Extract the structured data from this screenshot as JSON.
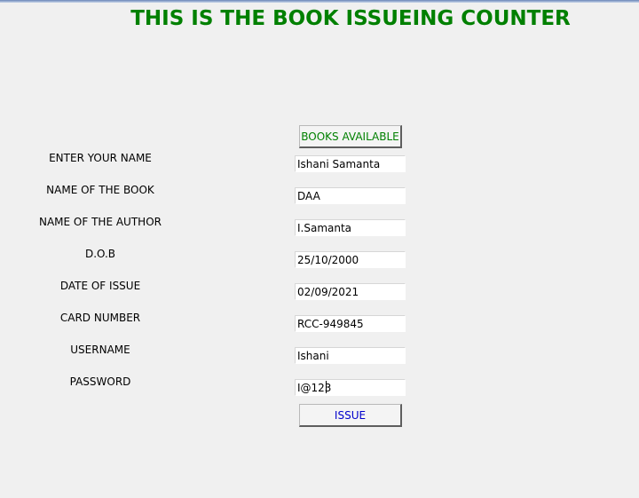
{
  "title": "THIS IS THE BOOK ISSUEING COUNTER",
  "buttons": {
    "books_available": "BOOKS AVAILABLE",
    "issue": "ISSUE"
  },
  "form": {
    "fields": [
      {
        "label": "ENTER YOUR NAME",
        "value": "Ishani Samanta"
      },
      {
        "label": "NAME OF THE BOOK",
        "value": "DAA"
      },
      {
        "label": "NAME OF THE AUTHOR",
        "value": "I.Samanta"
      },
      {
        "label": "D.O.B",
        "value": "25/10/2000"
      },
      {
        "label": "DATE OF ISSUE",
        "value": "02/09/2021"
      },
      {
        "label": "CARD NUMBER",
        "value": "RCC-949845"
      },
      {
        "label": "USERNAME",
        "value": "Ishani"
      },
      {
        "label": "PASSWORD",
        "value": "I@123"
      }
    ]
  },
  "colors": {
    "title": "#008000",
    "books_button_text": "#008000",
    "issue_button_text": "#0000cc",
    "background": "#f0f0f0"
  }
}
